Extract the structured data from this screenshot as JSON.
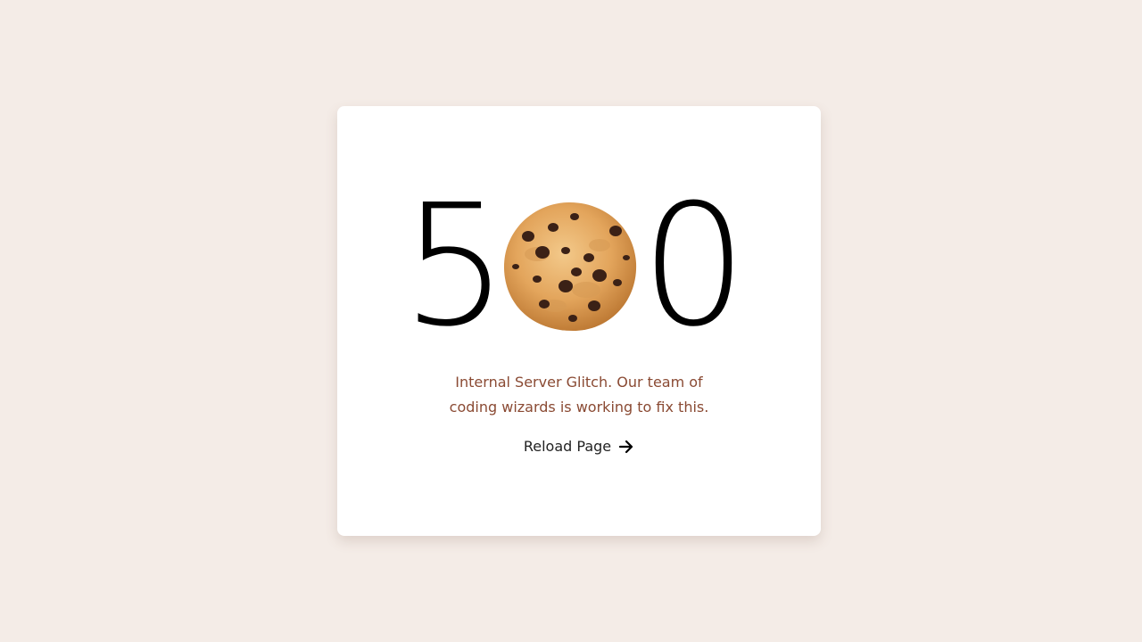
{
  "error": {
    "digit_first": "5",
    "digit_middle_icon": "cookie-icon",
    "digit_last": "0",
    "message_line1": "Internal Server Glitch. Our team of",
    "message_line2": "coding wizards is working to fix this."
  },
  "actions": {
    "reload_label": "Reload Page",
    "reload_icon": "arrow-right-icon"
  },
  "colors": {
    "background": "#f4ece7",
    "card": "#ffffff",
    "message_text": "#8a4a33",
    "link_text": "#222222"
  }
}
